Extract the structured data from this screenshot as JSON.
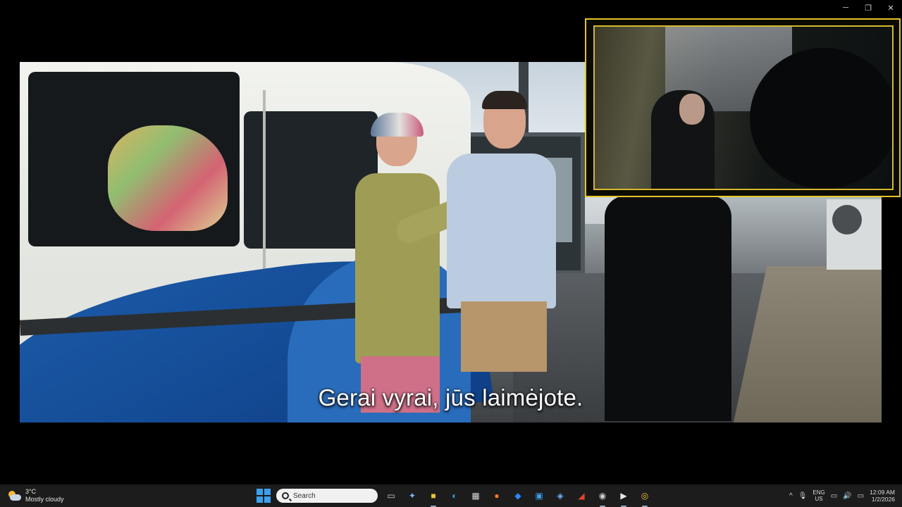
{
  "window_controls": {
    "minimize": "─",
    "restore": "❐",
    "close": "✕"
  },
  "video": {
    "subtitle": "Gerai vyrai, jūs laimėjote."
  },
  "taskbar": {
    "weather": {
      "temp": "3°C",
      "condition": "Mostly cloudy",
      "icon": "partly-cloudy-icon"
    },
    "search_placeholder": "Search",
    "apps": [
      {
        "name": "task-view-icon",
        "glyph": "▭"
      },
      {
        "name": "copilot-icon",
        "glyph": "✦"
      },
      {
        "name": "file-explorer-icon",
        "glyph": "■"
      },
      {
        "name": "edge-icon",
        "glyph": "◐"
      },
      {
        "name": "store-icon",
        "glyph": "▦"
      },
      {
        "name": "firefox-icon",
        "glyph": "●"
      },
      {
        "name": "dropbox-icon",
        "glyph": "◆"
      },
      {
        "name": "app-blue-icon",
        "glyph": "▣"
      },
      {
        "name": "app-outline-icon",
        "glyph": "◈"
      },
      {
        "name": "app-dark-icon",
        "glyph": "◢"
      },
      {
        "name": "app-record-icon",
        "glyph": "◉"
      },
      {
        "name": "media-player-icon",
        "glyph": "▶"
      },
      {
        "name": "chrome-icon",
        "glyph": "◎"
      }
    ],
    "tray": {
      "chevron": "^",
      "mic": "🎙",
      "lang_top": "ENG",
      "lang_bottom": "US",
      "display": "▭",
      "volume": "🔊",
      "battery": "▭",
      "time": "12:09 AM",
      "date": "1/2/2026"
    }
  }
}
